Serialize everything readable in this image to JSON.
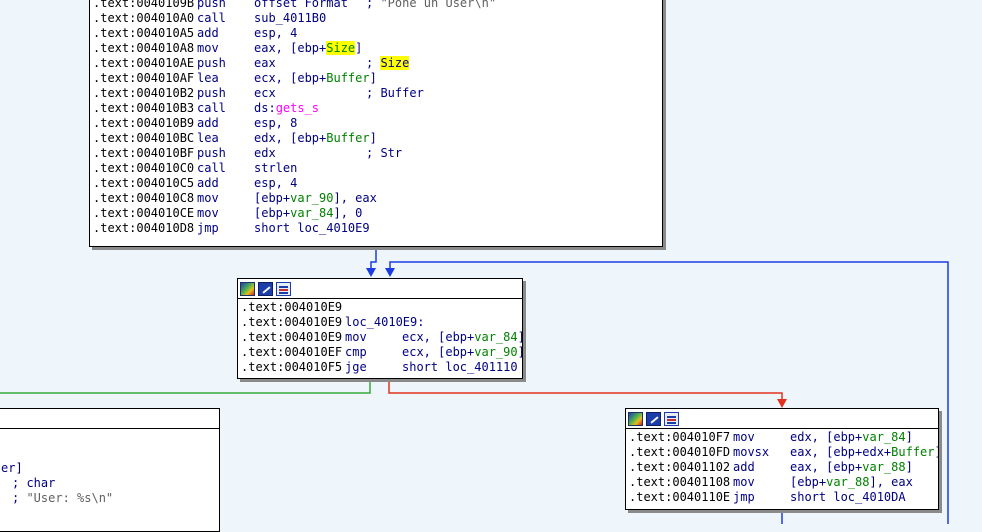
{
  "colors": {
    "background": "#eef6fb",
    "edge_blue": "#1b3be6",
    "edge_green": "#3aa83a",
    "edge_red": "#e0321e",
    "highlight": "#ffff00"
  },
  "node_a": {
    "lines": [
      {
        "addr": ".text:0040109B",
        "mn": "push",
        "segs": [
          {
            "t": "offset Format",
            "c": "op"
          }
        ],
        "comment": [
          {
            "t": "; ",
            "c": "cmt"
          },
          {
            "t": "\"Pone un User\\n\"",
            "c": "str"
          }
        ]
      },
      {
        "addr": ".text:004010A0",
        "mn": "call",
        "segs": [
          {
            "t": "sub_4011B0",
            "c": "op"
          }
        ]
      },
      {
        "addr": ".text:004010A5",
        "mn": "add",
        "segs": [
          {
            "t": "esp, 4",
            "c": "op"
          }
        ]
      },
      {
        "addr": ".text:004010A8",
        "mn": "mov",
        "segs": [
          {
            "t": "eax, [ebp+",
            "c": "op"
          },
          {
            "t": "Size",
            "c": "var hl"
          },
          {
            "t": "]",
            "c": "op"
          }
        ]
      },
      {
        "addr": ".text:004010AE",
        "mn": "push",
        "segs": [
          {
            "t": "eax",
            "c": "op"
          }
        ],
        "comment": [
          {
            "t": "; ",
            "c": "cmt"
          },
          {
            "t": "Size",
            "c": "cmt hl"
          }
        ]
      },
      {
        "addr": ".text:004010AF",
        "mn": "lea",
        "segs": [
          {
            "t": "ecx, [ebp+",
            "c": "op"
          },
          {
            "t": "Buffer",
            "c": "var"
          },
          {
            "t": "]",
            "c": "op"
          }
        ]
      },
      {
        "addr": ".text:004010B2",
        "mn": "push",
        "segs": [
          {
            "t": "ecx",
            "c": "op"
          }
        ],
        "comment": [
          {
            "t": "; Buffer",
            "c": "cmt"
          }
        ]
      },
      {
        "addr": ".text:004010B3",
        "mn": "call",
        "segs": [
          {
            "t": "ds:",
            "c": "op"
          },
          {
            "t": "gets_s",
            "c": "api"
          }
        ]
      },
      {
        "addr": ".text:004010B9",
        "mn": "add",
        "segs": [
          {
            "t": "esp, 8",
            "c": "op"
          }
        ]
      },
      {
        "addr": ".text:004010BC",
        "mn": "lea",
        "segs": [
          {
            "t": "edx, [ebp+",
            "c": "op"
          },
          {
            "t": "Buffer",
            "c": "var"
          },
          {
            "t": "]",
            "c": "op"
          }
        ]
      },
      {
        "addr": ".text:004010BF",
        "mn": "push",
        "segs": [
          {
            "t": "edx",
            "c": "op"
          }
        ],
        "comment": [
          {
            "t": "; Str",
            "c": "cmt"
          }
        ]
      },
      {
        "addr": ".text:004010C0",
        "mn": "call",
        "segs": [
          {
            "t": "strlen",
            "c": "op"
          }
        ]
      },
      {
        "addr": ".text:004010C5",
        "mn": "add",
        "segs": [
          {
            "t": "esp, 4",
            "c": "op"
          }
        ]
      },
      {
        "addr": ".text:004010C8",
        "mn": "mov",
        "segs": [
          {
            "t": "[ebp+",
            "c": "op"
          },
          {
            "t": "var_90",
            "c": "var"
          },
          {
            "t": "], eax",
            "c": "op"
          }
        ]
      },
      {
        "addr": ".text:004010CE",
        "mn": "mov",
        "segs": [
          {
            "t": "[ebp+",
            "c": "op"
          },
          {
            "t": "var_84",
            "c": "var"
          },
          {
            "t": "], 0",
            "c": "op"
          }
        ]
      },
      {
        "addr": ".text:004010D8",
        "mn": "jmp",
        "segs": [
          {
            "t": "short loc_4010E9",
            "c": "op"
          }
        ]
      }
    ]
  },
  "node_b": {
    "lines": [
      {
        "addr": ".text:004010E9",
        "mn": "",
        "segs": []
      },
      {
        "addr": ".text:004010E9",
        "mn": "",
        "label": "loc_4010E9:",
        "segs": []
      },
      {
        "addr": ".text:004010E9",
        "mn": "mov",
        "segs": [
          {
            "t": "ecx, [ebp+",
            "c": "op"
          },
          {
            "t": "var_84",
            "c": "var"
          },
          {
            "t": "]",
            "c": "op"
          }
        ]
      },
      {
        "addr": ".text:004010EF",
        "mn": "cmp",
        "segs": [
          {
            "t": "ecx, [ebp+",
            "c": "op"
          },
          {
            "t": "var_90",
            "c": "var"
          },
          {
            "t": "]",
            "c": "op"
          }
        ]
      },
      {
        "addr": ".text:004010F5",
        "mn": "jge",
        "segs": [
          {
            "t": "short loc_401110",
            "c": "op"
          }
        ]
      }
    ]
  },
  "node_c": {
    "lines": [
      {
        "addr": ".text:004010F7",
        "mn": "mov",
        "segs": [
          {
            "t": "edx, [ebp+",
            "c": "op"
          },
          {
            "t": "var_84",
            "c": "var"
          },
          {
            "t": "]",
            "c": "op"
          }
        ]
      },
      {
        "addr": ".text:004010FD",
        "mn": "movsx",
        "segs": [
          {
            "t": "eax, [ebp+edx+",
            "c": "op"
          },
          {
            "t": "Buffer",
            "c": "var"
          },
          {
            "t": "]",
            "c": "op"
          }
        ]
      },
      {
        "addr": ".text:00401102",
        "mn": "add",
        "segs": [
          {
            "t": "eax, [ebp+",
            "c": "op"
          },
          {
            "t": "var_88",
            "c": "var"
          },
          {
            "t": "]",
            "c": "op"
          }
        ]
      },
      {
        "addr": ".text:00401108",
        "mn": "mov",
        "segs": [
          {
            "t": "[ebp+",
            "c": "op"
          },
          {
            "t": "var_88",
            "c": "var"
          },
          {
            "t": "], eax",
            "c": "op"
          }
        ]
      },
      {
        "addr": ".text:0040110E",
        "mn": "jmp",
        "segs": [
          {
            "t": "short loc_4010DA",
            "c": "op"
          }
        ]
      }
    ]
  },
  "node_d": {
    "lines": [
      {
        "segs": [
          {
            "t": "er]",
            "c": "op"
          }
        ]
      },
      {
        "segs": [
          {
            "t": "; char",
            "c": "cmt"
          }
        ]
      },
      {
        "segs": [
          {
            "t": "; ",
            "c": "cmt"
          },
          {
            "t": "\"User: %s\\n\"",
            "c": "str"
          }
        ]
      }
    ]
  }
}
